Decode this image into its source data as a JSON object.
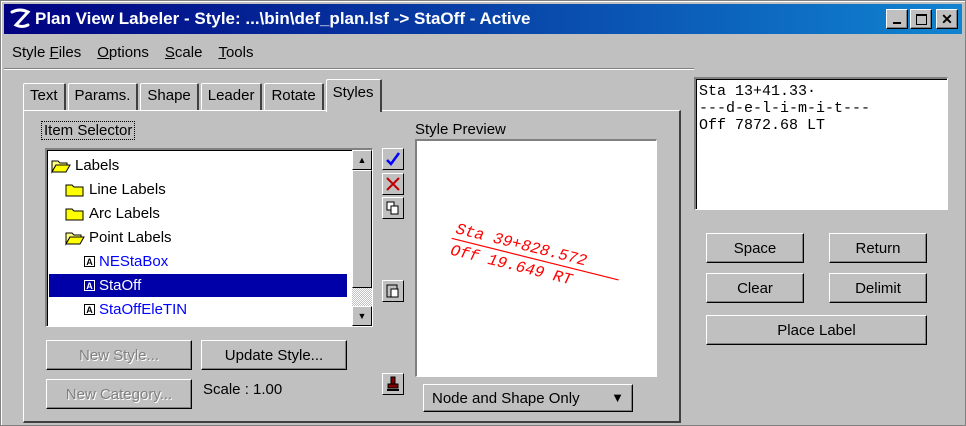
{
  "window": {
    "title": "Plan View Labeler - Style: ...\\bin\\def_plan.lsf -> StaOff - Active",
    "controls": [
      "minimize-icon",
      "maximize-icon",
      "close-icon"
    ]
  },
  "menu": [
    {
      "label": "Style Files",
      "mnemonic": "F"
    },
    {
      "label": "Options",
      "mnemonic": "O"
    },
    {
      "label": "Scale",
      "mnemonic": "S"
    },
    {
      "label": "Tools",
      "mnemonic": "T"
    }
  ],
  "tabs": [
    {
      "label": "Text"
    },
    {
      "label": "Params."
    },
    {
      "label": "Shape"
    },
    {
      "label": "Leader"
    },
    {
      "label": "Rotate"
    },
    {
      "label": "Styles",
      "active": true
    }
  ],
  "styles_tab": {
    "item_selector_label": "Item Selector",
    "style_preview_label": "Style Preview",
    "tree": [
      {
        "label": "Labels",
        "icon": "open-folder-icon",
        "level": 0
      },
      {
        "label": "Line Labels",
        "icon": "folder-icon",
        "level": 1
      },
      {
        "label": "Arc Labels",
        "icon": "folder-icon",
        "level": 1
      },
      {
        "label": "Point Labels",
        "icon": "open-folder-icon",
        "level": 1
      },
      {
        "label": "NEStaBox",
        "icon": "style-icon",
        "level": 2
      },
      {
        "label": "StaOff",
        "icon": "style-icon",
        "level": 2,
        "selected": true
      },
      {
        "label": "StaOffEleTIN",
        "icon": "style-icon",
        "level": 2
      }
    ],
    "new_style_button": "New Style...",
    "update_style_button": "Update Style...",
    "new_category_button": "New Category...",
    "scale_text": "Scale : 1.00",
    "preview": {
      "line1": "Sta 39+828.572",
      "line2": "Off 19.649 RT",
      "color": "#ff0000"
    },
    "preview_mode": "Node and Shape Only",
    "side_icons": [
      "checkmark-icon",
      "delete-x-icon",
      "copy-icon",
      "paste-icon",
      "stamp-icon"
    ]
  },
  "label_text": "Sta 13+41.33·\n---d-e-l-i-m-i-t---\nOff 7872.68 LT",
  "buttons": {
    "space": "Space",
    "return": "Return",
    "clear": "Clear",
    "delimit": "Delimit",
    "place_label": "Place Label"
  }
}
